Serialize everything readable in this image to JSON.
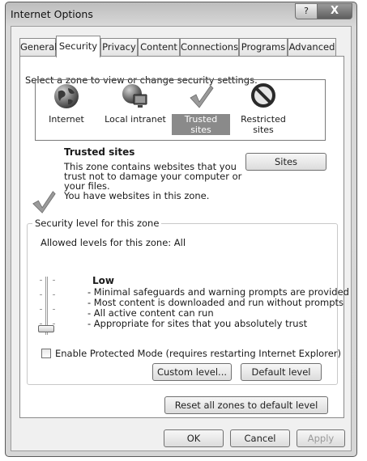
{
  "window": {
    "title": "Internet Options",
    "help_label": "?",
    "close_label": "X"
  },
  "tabs": [
    {
      "label": "General"
    },
    {
      "label": "Security"
    },
    {
      "label": "Privacy"
    },
    {
      "label": "Content"
    },
    {
      "label": "Connections"
    },
    {
      "label": "Programs"
    },
    {
      "label": "Advanced"
    }
  ],
  "zones": {
    "prompt": "Select a zone to view or change security settings.",
    "items": [
      {
        "label": "Internet",
        "icon": "globe-icon"
      },
      {
        "label": "Local intranet",
        "icon": "intranet-icon"
      },
      {
        "label": "Trusted sites",
        "icon": "checkmark-icon",
        "selected": true
      },
      {
        "label": "Restricted sites",
        "label_line1": "Restricted",
        "label_line2": "sites",
        "icon": "no-entry-icon"
      }
    ]
  },
  "zone_info": {
    "title": "Trusted sites",
    "description_lines": [
      "This zone contains websites that you",
      "trust not to damage your computer or",
      "your files.",
      "You have websites in this zone."
    ],
    "sites_button": "Sites"
  },
  "security_level": {
    "group_label": "Security level for this zone",
    "allowed_label": "Allowed levels for this zone: All",
    "level_name": "Low",
    "level": 0,
    "bullets": [
      "- Minimal safeguards and warning prompts are provided",
      "- Most content is downloaded and run without prompts",
      "- All active content can run",
      "- Appropriate for sites that you absolutely trust"
    ],
    "protected_mode_label": "Enable Protected Mode (requires restarting Internet Explorer)",
    "protected_mode_checked": false,
    "custom_level_button": "Custom level...",
    "default_level_button": "Default level"
  },
  "reset_button": "Reset all zones to default level",
  "footer": {
    "ok": "OK",
    "cancel": "Cancel",
    "apply": "Apply"
  }
}
